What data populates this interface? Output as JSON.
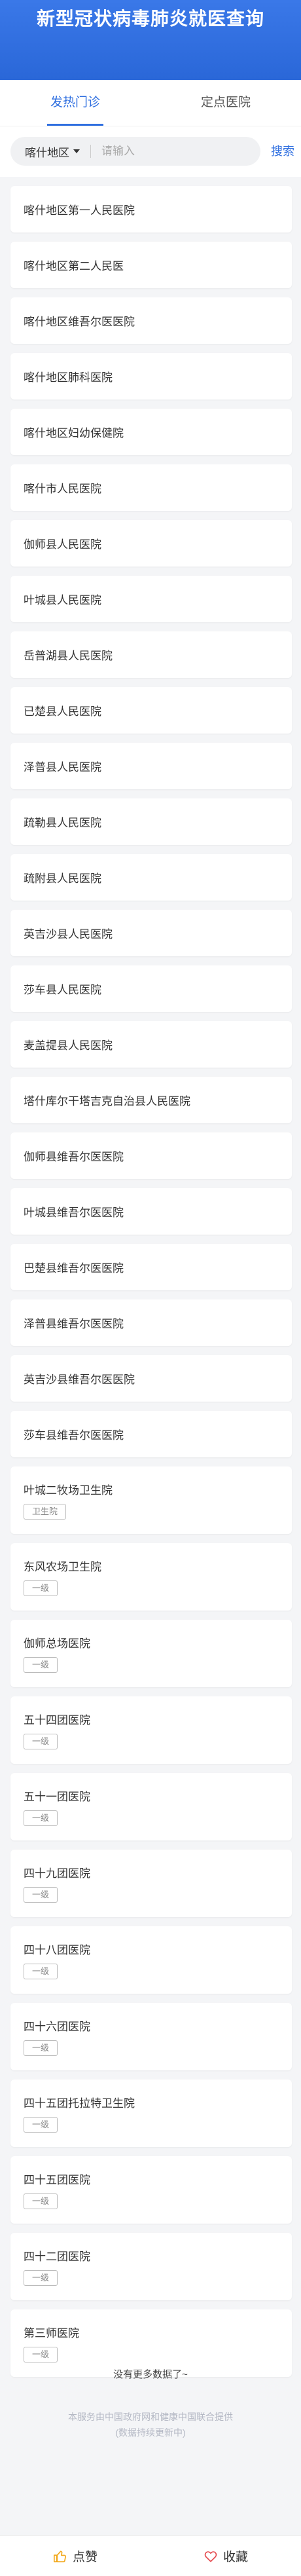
{
  "header": {
    "title": "新型冠状病毒肺炎就医查询"
  },
  "tabs": [
    {
      "label": "发热门诊",
      "active": true
    },
    {
      "label": "定点医院",
      "active": false
    }
  ],
  "search": {
    "region": "喀什地区",
    "placeholder": "请输入",
    "value": "",
    "button_label": "搜索"
  },
  "hospitals": [
    {
      "name": "喀什地区第一人民医院",
      "tag": ""
    },
    {
      "name": "喀什地区第二人民医",
      "tag": ""
    },
    {
      "name": "喀什地区维吾尔医医院",
      "tag": ""
    },
    {
      "name": "喀什地区肺科医院",
      "tag": ""
    },
    {
      "name": "喀什地区妇幼保健院",
      "tag": ""
    },
    {
      "name": "喀什市人民医院",
      "tag": ""
    },
    {
      "name": "伽师县人民医院",
      "tag": ""
    },
    {
      "name": "叶城县人民医院",
      "tag": ""
    },
    {
      "name": "岳普湖县人民医院",
      "tag": ""
    },
    {
      "name": "已楚县人民医院",
      "tag": ""
    },
    {
      "name": "泽普县人民医院",
      "tag": ""
    },
    {
      "name": "疏勒县人民医院",
      "tag": ""
    },
    {
      "name": "疏附县人民医院",
      "tag": ""
    },
    {
      "name": "英吉沙县人民医院",
      "tag": ""
    },
    {
      "name": "莎车县人民医院",
      "tag": ""
    },
    {
      "name": "麦盖提县人民医院",
      "tag": ""
    },
    {
      "name": "塔什库尔干塔吉克自治县人民医院",
      "tag": ""
    },
    {
      "name": "伽师县维吾尔医医院",
      "tag": ""
    },
    {
      "name": "叶城县维吾尔医医院",
      "tag": ""
    },
    {
      "name": "巴楚县维吾尔医医院",
      "tag": ""
    },
    {
      "name": "泽普县维吾尔医医院",
      "tag": ""
    },
    {
      "name": "英吉沙县维吾尔医医院",
      "tag": ""
    },
    {
      "name": "莎车县维吾尔医医院",
      "tag": ""
    },
    {
      "name": "叶城二牧场卫生院",
      "tag": "卫生院"
    },
    {
      "name": "东风农场卫生院",
      "tag": "一级"
    },
    {
      "name": "伽师总场医院",
      "tag": "一级"
    },
    {
      "name": "五十四团医院",
      "tag": "一级"
    },
    {
      "name": "五十一团医院",
      "tag": "一级"
    },
    {
      "name": "四十九团医院",
      "tag": "一级"
    },
    {
      "name": "四十八团医院",
      "tag": "一级"
    },
    {
      "name": "四十六团医院",
      "tag": "一级"
    },
    {
      "name": "四十五团托拉特卫生院",
      "tag": "一级"
    },
    {
      "name": "四十五团医院",
      "tag": "一级"
    },
    {
      "name": "四十二团医院",
      "tag": "一级"
    },
    {
      "name": "第三师医院",
      "tag": "一级"
    }
  ],
  "no_more_text": "没有更多数据了~",
  "source_text": {
    "line1": "本服务由中国政府网和健康中国联合提供",
    "line2": "(数据持续更新中)"
  },
  "footer": {
    "like_label": "点赞",
    "favorite_label": "收藏"
  },
  "colors": {
    "primary": "#2f6fe0",
    "background": "#f4f5f7"
  }
}
